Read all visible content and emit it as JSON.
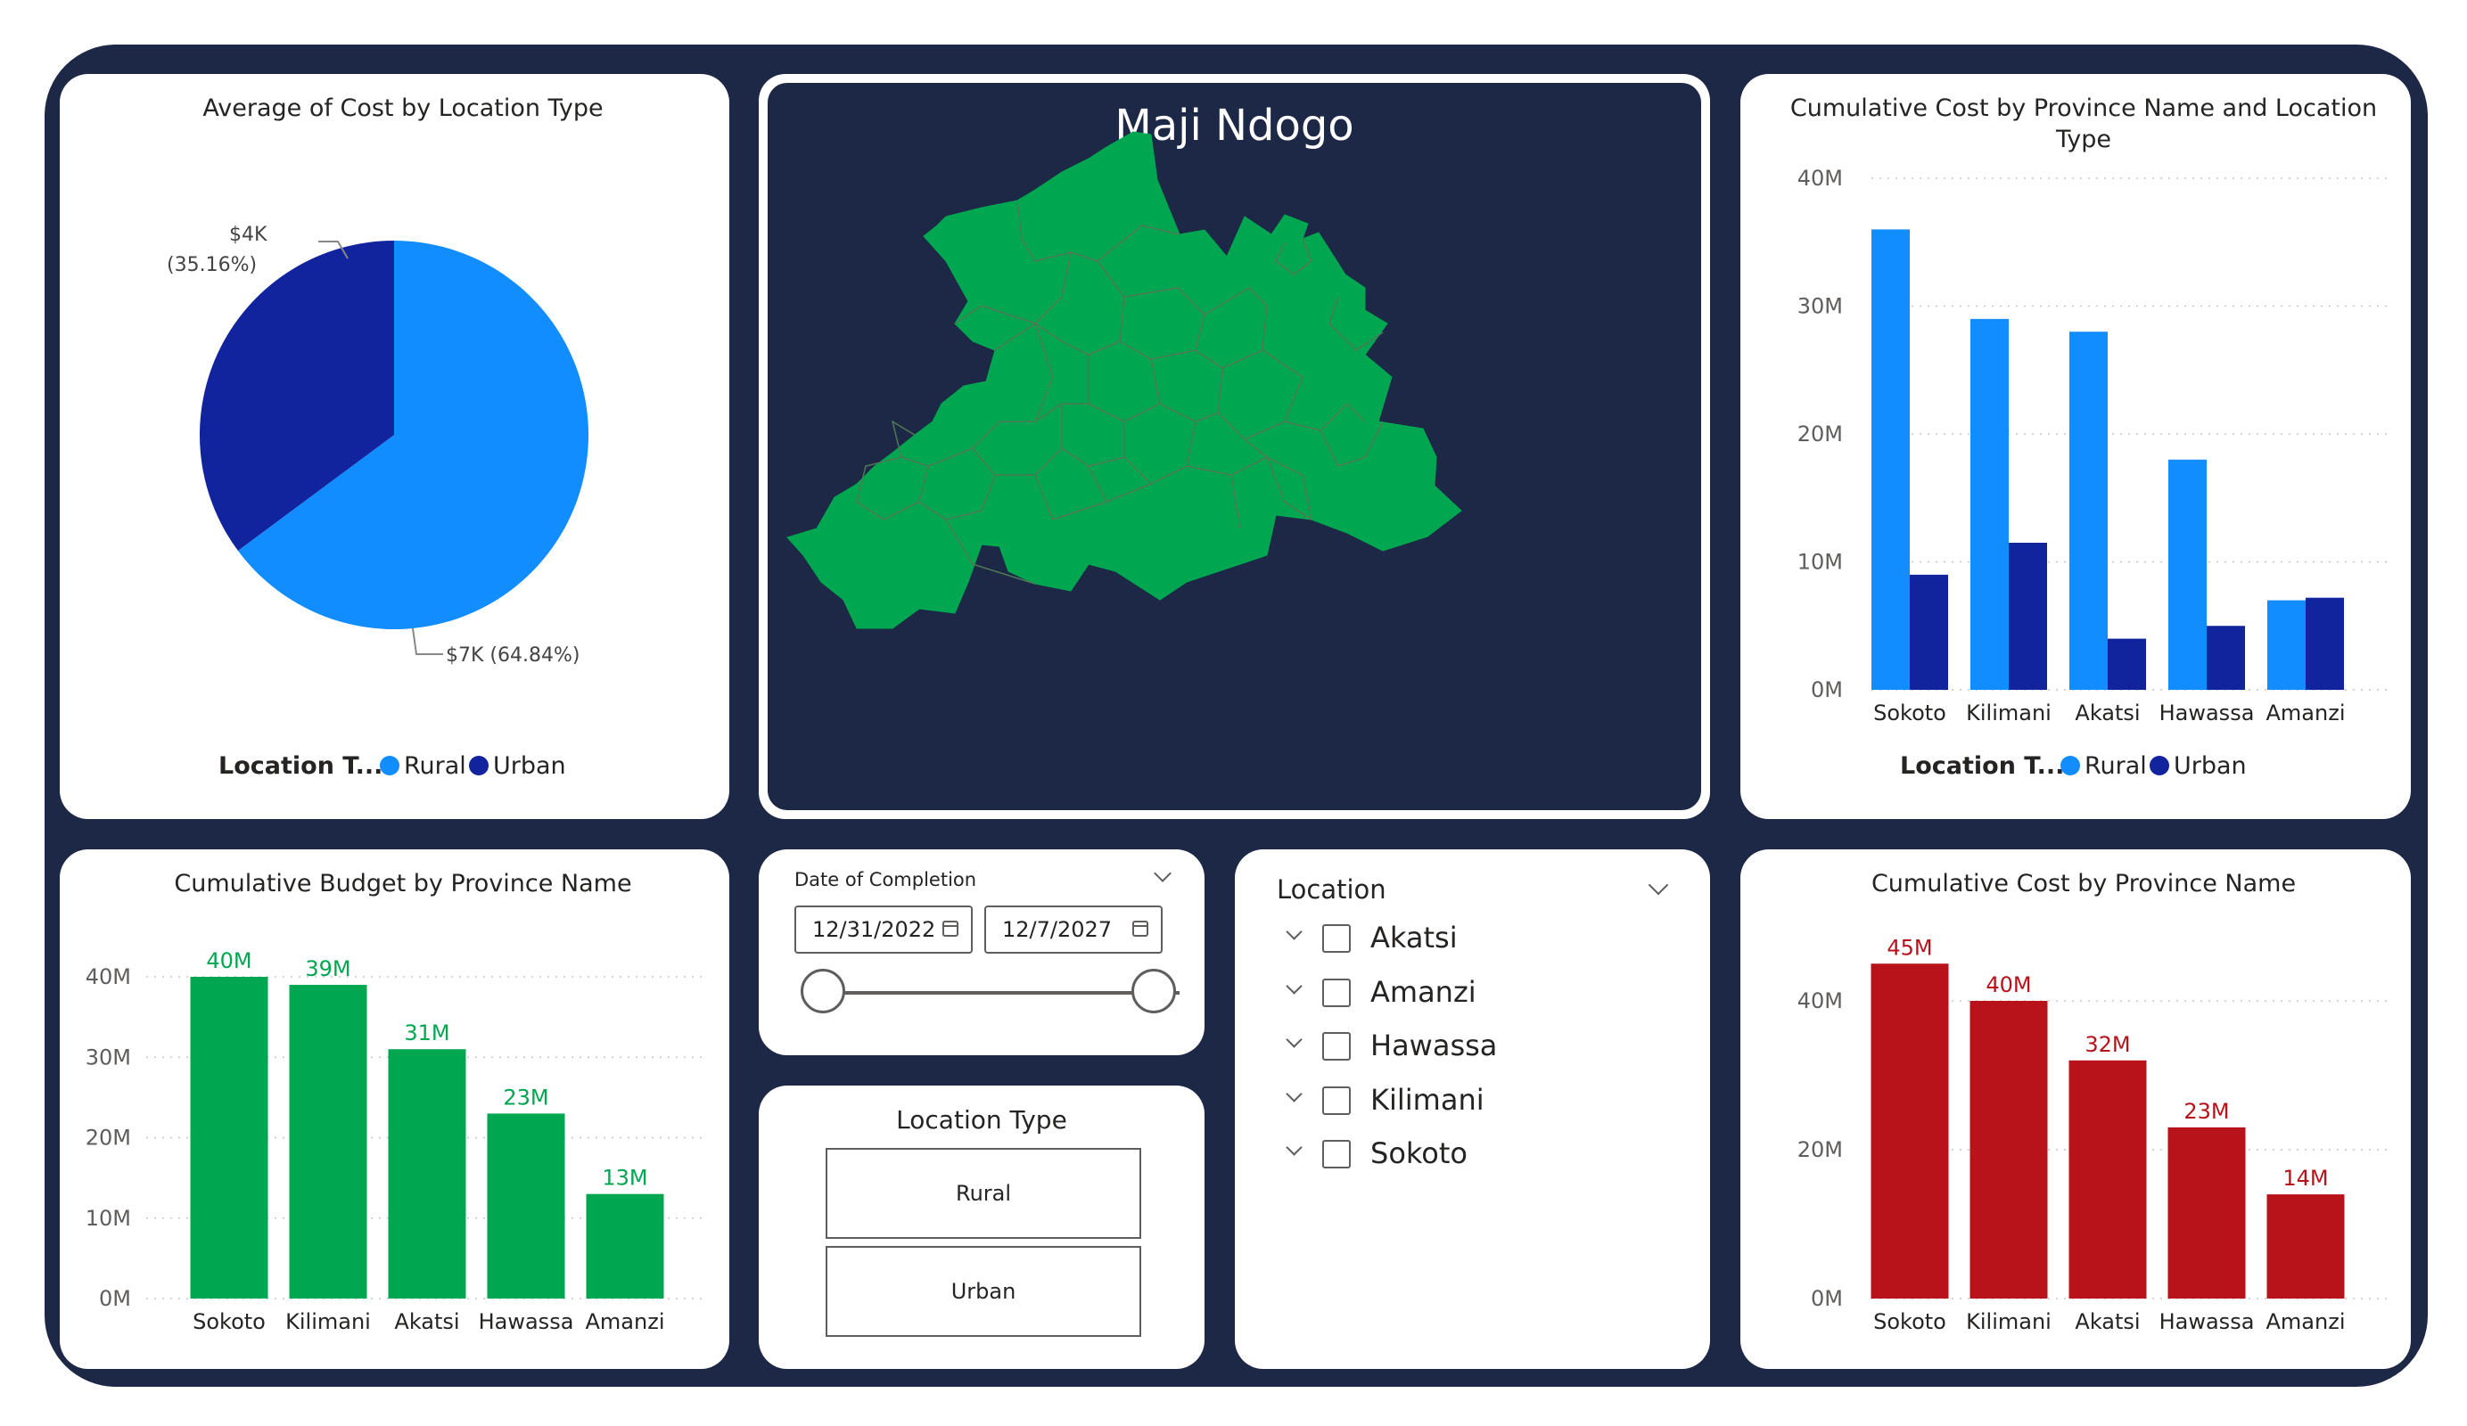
{
  "pie": {
    "title": "Average of Cost by Location Type",
    "legend_title": "Location T...",
    "slices": [
      {
        "name": "Rural",
        "pct": 64.84,
        "label": "$7K (64.84%)",
        "color": "#118dff"
      },
      {
        "name": "Urban",
        "pct": 35.16,
        "label_line1": "$4K",
        "label_line2": "(35.16%)",
        "color": "#12239e"
      }
    ]
  },
  "map": {
    "title": "Maji Ndogo",
    "land_color": "#00a650",
    "border_color": "#5a6e5a"
  },
  "date_slicer": {
    "label": "Date of Completion",
    "start": "12/31/2022",
    "end": "12/7/2027",
    "range_selected": [
      0,
      1
    ]
  },
  "location_type_slicer": {
    "title": "Location Type",
    "options": [
      "Rural",
      "Urban"
    ]
  },
  "location_slicer": {
    "title": "Location",
    "items": [
      "Akatsi",
      "Amanzi",
      "Hawassa",
      "Kilimani",
      "Sokoto"
    ]
  },
  "colors": {
    "rural": "#118dff",
    "urban": "#12239e",
    "budget": "#00a650",
    "cost": "#b8121b",
    "frame": "#1c2846"
  },
  "chart_data": [
    {
      "type": "pie",
      "title": "Average of Cost by Location Type",
      "legend_title": "Location T...",
      "categories": [
        "Rural",
        "Urban"
      ],
      "values": [
        7000,
        4000
      ],
      "percentages": [
        64.84,
        35.16
      ],
      "labels": [
        "$7K (64.84%)",
        "$4K (35.16%)"
      ]
    },
    {
      "type": "bar",
      "title": "Cumulative Cost by Province Name and Location Type",
      "legend_title": "Location T...",
      "categories": [
        "Sokoto",
        "Kilimani",
        "Akatsi",
        "Hawassa",
        "Amanzi"
      ],
      "series": [
        {
          "name": "Rural",
          "values": [
            36,
            29,
            28,
            18,
            7
          ]
        },
        {
          "name": "Urban",
          "values": [
            9,
            11.5,
            4,
            5,
            7.2
          ]
        }
      ],
      "units": "M",
      "yticks": [
        "0M",
        "10M",
        "20M",
        "30M",
        "40M"
      ],
      "ylim": [
        0,
        40
      ],
      "grid": true,
      "legend": "bottom"
    },
    {
      "type": "bar",
      "title": "Cumulative Budget by Province Name",
      "categories": [
        "Sokoto",
        "Kilimani",
        "Akatsi",
        "Hawassa",
        "Amanzi"
      ],
      "values": [
        40,
        39,
        31,
        23,
        13
      ],
      "data_labels": [
        "40M",
        "39M",
        "31M",
        "23M",
        "13M"
      ],
      "units": "M",
      "yticks": [
        "0M",
        "10M",
        "20M",
        "30M",
        "40M"
      ],
      "ylim": [
        0,
        40
      ],
      "grid": true
    },
    {
      "type": "bar",
      "title": "Cumulative Cost by Province Name",
      "categories": [
        "Sokoto",
        "Kilimani",
        "Akatsi",
        "Hawassa",
        "Amanzi"
      ],
      "values": [
        45,
        40,
        32,
        23,
        14
      ],
      "data_labels": [
        "45M",
        "40M",
        "32M",
        "23M",
        "14M"
      ],
      "units": "M",
      "yticks": [
        "0M",
        "20M",
        "40M"
      ],
      "ylim": [
        0,
        40
      ],
      "grid": true
    }
  ]
}
